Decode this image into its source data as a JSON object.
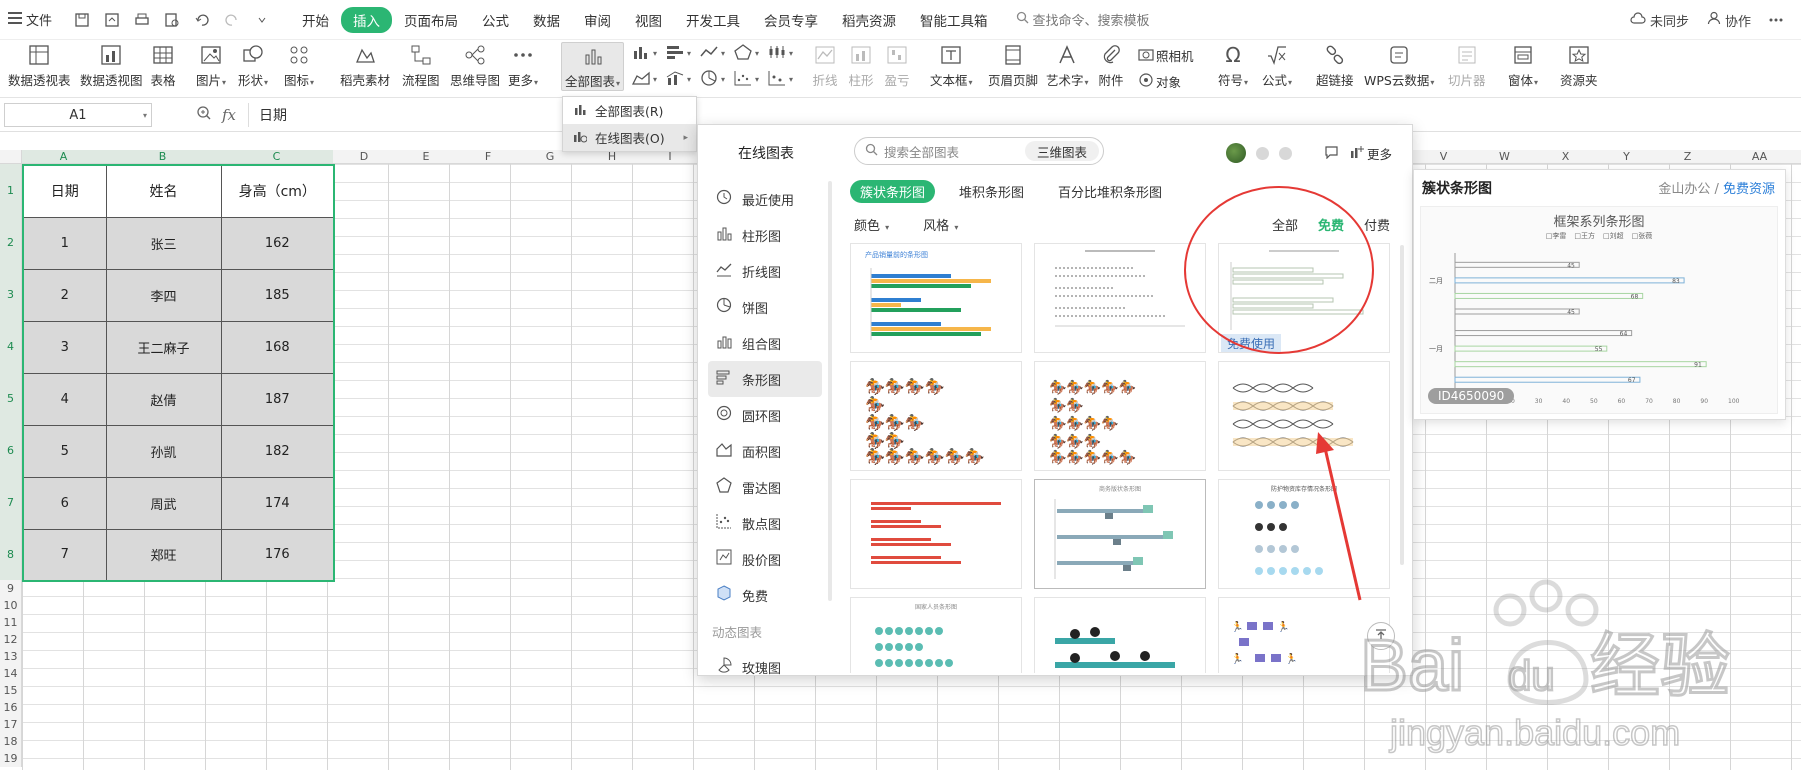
{
  "menubar": {
    "file_label": "文件",
    "tabs": [
      {
        "label": "开始",
        "active": false
      },
      {
        "label": "插入",
        "active": true
      },
      {
        "label": "页面布局",
        "active": false
      },
      {
        "label": "公式",
        "active": false
      },
      {
        "label": "数据",
        "active": false
      },
      {
        "label": "审阅",
        "active": false
      },
      {
        "label": "视图",
        "active": false
      },
      {
        "label": "开发工具",
        "active": false
      },
      {
        "label": "会员专享",
        "active": false
      },
      {
        "label": "稻壳资源",
        "active": false
      },
      {
        "label": "智能工具箱",
        "active": false
      }
    ],
    "search_placeholder": "查找命令、搜索模板",
    "sync_label": "未同步",
    "collab_label": "协作",
    "accent": "#2bb673"
  },
  "ribbon": {
    "pivot_table": "数据透视表",
    "pivot_chart": "数据透视图",
    "table": "表格",
    "picture": "图片",
    "shape": "形状",
    "icon": "图标",
    "docer_material": "稻壳素材",
    "flowchart": "流程图",
    "mindmap": "思维导图",
    "more": "更多",
    "all_charts": "全部图表",
    "line": "折线",
    "column": "柱形",
    "winloss": "盈亏",
    "textbox": "文本框",
    "header_footer": "页眉页脚",
    "wordart": "艺术字",
    "attachment": "附件",
    "camera": "照相机",
    "object": "对象",
    "symbol": "符号",
    "formula": "公式",
    "hyperlink": "超链接",
    "wps_cloud": "WPS云数据",
    "slicer": "切片器",
    "window": "窗体",
    "resource": "资源夹"
  },
  "formula_bar": {
    "cell_ref": "A1",
    "fx": "fx",
    "content": "日期"
  },
  "sheet": {
    "columns": [
      "A",
      "B",
      "C",
      "D",
      "E",
      "F",
      "G",
      "H",
      "I",
      "V",
      "W",
      "X",
      "Y",
      "Z",
      "AA"
    ],
    "rows_extra": [
      "9",
      "10",
      "11",
      "12",
      "13",
      "14",
      "15",
      "16",
      "17",
      "18",
      "19"
    ],
    "headers": [
      "日期",
      "姓名",
      "身高（cm）"
    ],
    "rows": [
      [
        "1",
        "张三",
        "162"
      ],
      [
        "2",
        "李四",
        "185"
      ],
      [
        "3",
        "王二麻子",
        "168"
      ],
      [
        "4",
        "赵倩",
        "187"
      ],
      [
        "5",
        "孙凯",
        "182"
      ],
      [
        "6",
        "周武",
        "174"
      ],
      [
        "7",
        "郑旺",
        "176"
      ]
    ]
  },
  "dropdown": {
    "item_all": "全部图表(R)",
    "item_online": "在线图表(O)"
  },
  "online_panel": {
    "title": "在线图表",
    "search_placeholder": "搜索全部图表",
    "btn_3d": "三维图表",
    "more": "更多",
    "sidebar": [
      {
        "label": "最近使用",
        "icon": "clock-icon",
        "active": false
      },
      {
        "label": "柱形图",
        "icon": "column-chart-icon",
        "active": false
      },
      {
        "label": "折线图",
        "icon": "line-chart-icon",
        "active": false
      },
      {
        "label": "饼图",
        "icon": "pie-chart-icon",
        "active": false
      },
      {
        "label": "组合图",
        "icon": "combo-chart-icon",
        "active": false
      },
      {
        "label": "条形图",
        "icon": "bar-chart-icon",
        "active": true
      },
      {
        "label": "圆环图",
        "icon": "donut-chart-icon",
        "active": false
      },
      {
        "label": "面积图",
        "icon": "area-chart-icon",
        "active": false
      },
      {
        "label": "雷达图",
        "icon": "radar-chart-icon",
        "active": false
      },
      {
        "label": "散点图",
        "icon": "scatter-chart-icon",
        "active": false
      },
      {
        "label": "股价图",
        "icon": "stock-chart-icon",
        "active": false
      },
      {
        "label": "免费",
        "icon": "free-icon",
        "active": false
      }
    ],
    "dynamic_group": "动态图表",
    "rose_chart": "玫瑰图",
    "subtabs": [
      "簇状条形图",
      "堆积条形图",
      "百分比堆积条形图"
    ],
    "filter_color": "颜色",
    "filter_style": "风格",
    "price_all": "全部",
    "price_free": "免费",
    "price_paid": "付费",
    "free_use": "免费使用",
    "thumb_titles": [
      "产品销量前的条形图",
      "",
      "",
      "",
      "",
      "",
      "",
      "商务版状条形图",
      "防护物资库存情况条形图",
      "国家人员条形图",
      "",
      ""
    ]
  },
  "preview": {
    "title": "簇状条形图",
    "source": "金山办公",
    "source_sep": " / ",
    "source_link": "免费资源",
    "chart_title": "框架系列条形图",
    "id": "ID4650090",
    "legend": [
      "李雷",
      "王方",
      "刘超",
      "张薇"
    ],
    "categories": [
      "二月",
      "一月"
    ],
    "values": [
      45,
      83,
      68,
      45,
      64,
      55,
      91,
      67
    ],
    "xticks": [
      "0",
      "10",
      "20",
      "30",
      "40",
      "50",
      "60",
      "70",
      "80",
      "90",
      "100"
    ]
  },
  "watermark": {
    "brand": "Bai",
    "brand2": "du",
    "cn": "经验",
    "url": "jingyan.baidu.com"
  }
}
